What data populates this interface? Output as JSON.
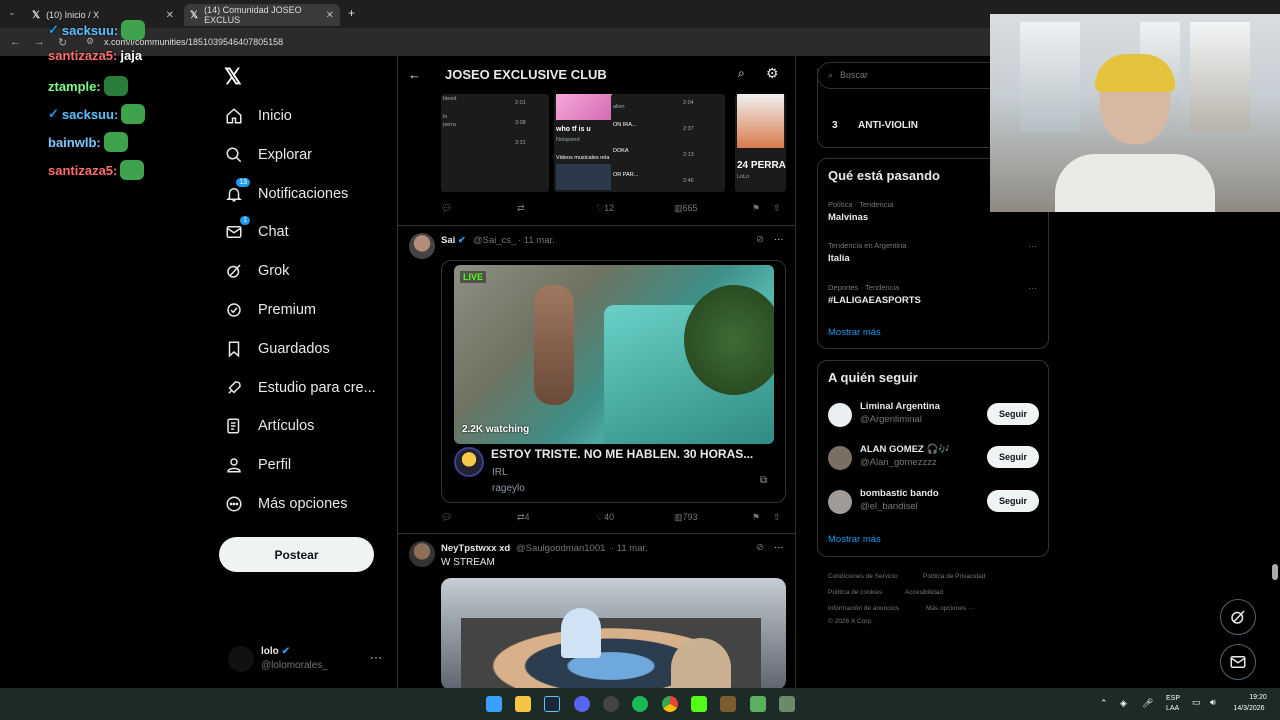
{
  "browser": {
    "tabs": [
      {
        "label": "(10) Inicio / X"
      },
      {
        "label": "(14) Comunidad JOSEO EXCLUS"
      }
    ],
    "url": "x.com/i/communities/1851039546407805158"
  },
  "chat": [
    {
      "user": "sacksuu:",
      "msg": "",
      "color": "#5dc1ff"
    },
    {
      "user": "santizaza5:",
      "msg": "jaja",
      "color": "#ff6f6f"
    },
    {
      "user": "ztample:",
      "msg": "",
      "color": "#7dff8c"
    },
    {
      "user": "sacksuu:",
      "msg": "",
      "color": "#5dc1ff"
    },
    {
      "user": "bainwlb:",
      "msg": "",
      "color": "#7ec8ff"
    },
    {
      "user": "santizaza5:",
      "msg": "",
      "color": "#ff6f6f"
    }
  ],
  "nav": {
    "items": [
      {
        "label": "Inicio",
        "icon": "home-icon"
      },
      {
        "label": "Explorar",
        "icon": "search-icon"
      },
      {
        "label": "Notificaciones",
        "icon": "bell-icon",
        "badge": "13"
      },
      {
        "label": "Chat",
        "icon": "mail-icon",
        "badge": "1"
      },
      {
        "label": "Grok",
        "icon": "grok-icon"
      },
      {
        "label": "Premium",
        "icon": "premium-icon"
      },
      {
        "label": "Guardados",
        "icon": "bookmark-icon"
      },
      {
        "label": "Estudio para cre...",
        "icon": "rocket-icon"
      },
      {
        "label": "Artículos",
        "icon": "article-icon"
      },
      {
        "label": "Perfil",
        "icon": "person-icon"
      },
      {
        "label": "Más opciones",
        "icon": "more-icon"
      }
    ],
    "post_label": "Postear",
    "profile": {
      "name": "lolo",
      "handle": "@lolomorales_"
    }
  },
  "community": {
    "title": "JOSEO EXCLUSIVE CLUB"
  },
  "top_thumbs": {
    "thumb1_lines": [
      "bleed",
      "lo",
      "perra",
      "2:01",
      "3:08",
      "3:31"
    ],
    "thumb2": {
      "title": "who tf is u",
      "sub": "Netspend",
      "foot": "Videos musicales rela"
    },
    "thumb3_lines": [
      "alien",
      "ON IRA...",
      "DOKA",
      "OR PAR..."
    ],
    "thumb3_times": [
      "2:04",
      "2:37",
      "2:13",
      "2:46"
    ],
    "thumb4": {
      "title": "24 PERRA",
      "sub": "LoLo"
    },
    "actions": {
      "likes": "12",
      "views": "665"
    }
  },
  "post1": {
    "name": "Sai",
    "handle": "@Sai_cs_",
    "date": "· 11 mar.",
    "live_badge": "LIVE",
    "watching": "2.2K watching",
    "stream_title": "ESTOY TRISTE. NO ME HABLEN. 30 HORAS...",
    "category": "IRL",
    "channel": "rageylo",
    "actions": {
      "reposts": "4",
      "likes": "40",
      "views": "793"
    }
  },
  "post2": {
    "name": "NeyTpstwxx xd",
    "handle": "@Saulgoodman1001",
    "date": "· 11 mar.",
    "text": "W STREAM"
  },
  "right": {
    "search_placeholder": "Buscar",
    "top_item": {
      "rank": "3",
      "label": "ANTI-VIOLIN"
    },
    "trends_title": "Qué está pasando",
    "trends": [
      {
        "meta": "Política · Tendencia",
        "name": "Malvinas"
      },
      {
        "meta": "Tendencia en Argentina",
        "name": "Italia"
      },
      {
        "meta": "Deportes · Tendencia",
        "name": "#LALIGAEASPORTS"
      }
    ],
    "show_more": "Mostrar más",
    "follow_title": "A quién seguir",
    "follow": [
      {
        "name": "Liminal Argentina",
        "handle": "@Argenliminal",
        "btn": "Seguir"
      },
      {
        "name": "ALAN GOMEZ 🎧🎶",
        "handle": "@Alan_gomezzzz",
        "btn": "Seguir"
      },
      {
        "name": "bombastic bando",
        "handle": "@el_bandisel",
        "btn": "Seguir"
      }
    ],
    "footer": [
      "Condiciones de Servicio",
      "Política de Privacidad",
      "Política de cookies",
      "Accesibilidad",
      "Información de anuncios",
      "Más opciones ···",
      "© 2026 X Corp."
    ]
  },
  "taskbar": {
    "lang": "ESP",
    "lang2": "LAA",
    "time": "19:20",
    "date": "14/3/2026"
  }
}
